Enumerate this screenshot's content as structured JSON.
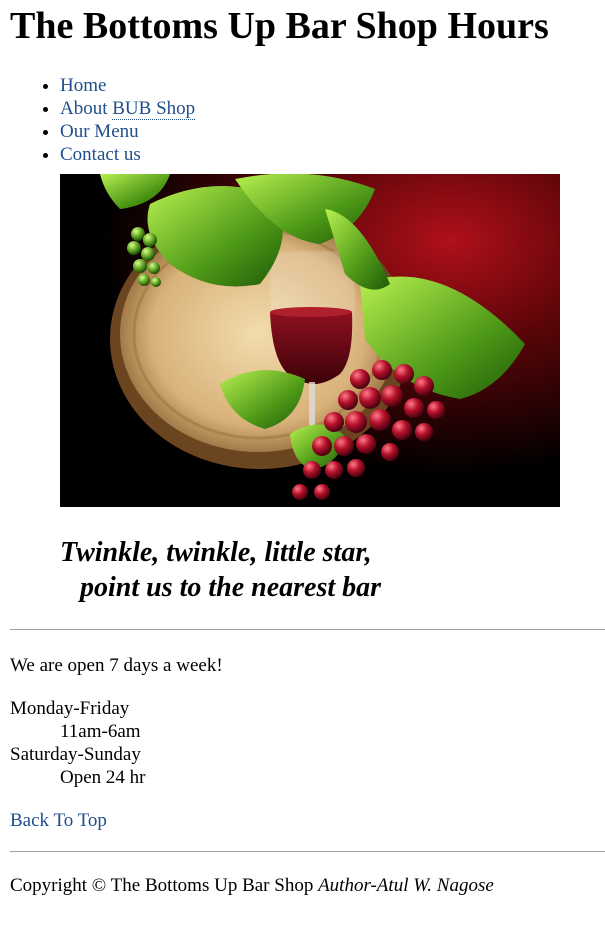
{
  "page": {
    "title": "The Bottoms Up Bar Shop Hours"
  },
  "nav": {
    "items": [
      {
        "label": "Home"
      },
      {
        "label_prefix": "About ",
        "label_abbr": "BUB Shop"
      },
      {
        "label": "Our Menu"
      },
      {
        "label": "Contact us"
      }
    ]
  },
  "hero": {
    "icon": "wine-barrel-grapes-image"
  },
  "quote": {
    "line1": "Twinkle, twinkle, little star,",
    "line2": "point us to the nearest bar"
  },
  "hours": {
    "intro": "We are open 7 days a week!",
    "weekday_label": "Monday-Friday",
    "weekday_time": "11am-6am",
    "weekend_label": "Saturday-Sunday",
    "weekend_time": "Open 24 hr"
  },
  "back_to_top": "Back To Top",
  "footer": {
    "copyright": "Copyright © The Bottoms Up Bar Shop",
    "author": "Author-Atul W. Nagose"
  }
}
